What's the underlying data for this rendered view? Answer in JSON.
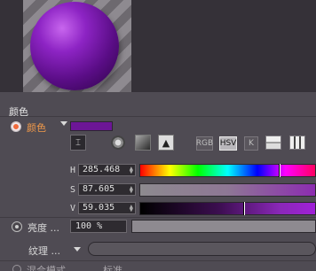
{
  "section": {
    "title": "颜色"
  },
  "color": {
    "label": "颜色",
    "swatch_color": "#6c1696",
    "toolbar": {
      "rgb": "RGB",
      "hsv": "HSV",
      "k": "K",
      "picker_icon": "eyedropper-icon",
      "wheel_icon": "color-wheel-icon",
      "spectrum_icon": "spectrum-icon",
      "image_icon": "image-icon",
      "swatches_icon": "swatches-icon",
      "grid_icon": "mixer-icon"
    }
  },
  "hsv": {
    "h": {
      "label": "H",
      "value": "285.468",
      "fraction": 0.793
    },
    "s": {
      "label": "S",
      "value": "87.605",
      "fraction": 0.876
    },
    "v": {
      "label": "V",
      "value": "59.035",
      "fraction": 0.59
    }
  },
  "brightness": {
    "label": "亮度 ...",
    "value": "100 %",
    "fraction": 1.0
  },
  "texture": {
    "label": "纹理 ..."
  },
  "mix": {
    "label": "混合模式",
    "value": "标准"
  }
}
